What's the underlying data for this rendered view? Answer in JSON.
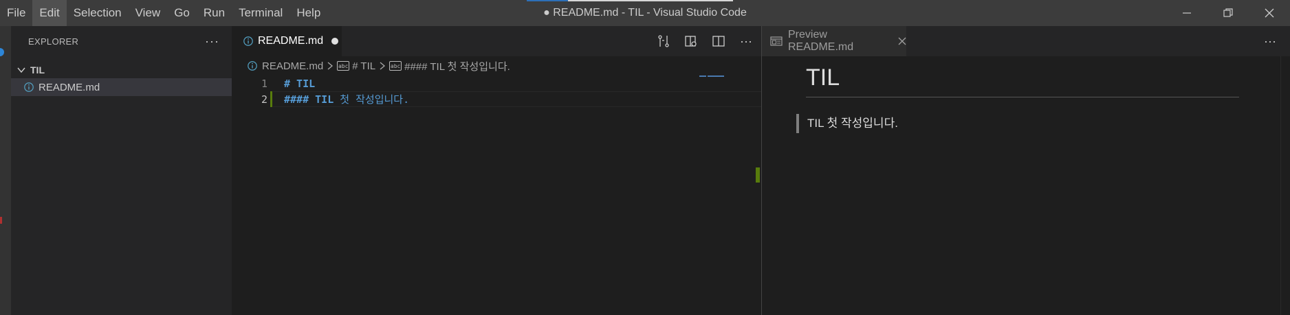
{
  "window": {
    "title": "● README.md - TIL - Visual Studio Code"
  },
  "menu": {
    "items": [
      "File",
      "Edit",
      "Selection",
      "View",
      "Go",
      "Run",
      "Terminal",
      "Help"
    ],
    "active": "Edit"
  },
  "sidebar": {
    "title": "EXPLORER",
    "more": "···",
    "folder": "TIL",
    "files": [
      {
        "name": "README.md",
        "icon": "info-icon"
      }
    ]
  },
  "editor": {
    "tab": {
      "label": "README.md",
      "dirty": true
    },
    "breadcrumb": {
      "file": "README.md",
      "h1": "# TIL",
      "h4": "#### TIL 첫 작성입니다."
    },
    "lines": [
      {
        "number": "1",
        "prefix": "# TIL",
        "rest": ""
      },
      {
        "number": "2",
        "prefix": "#### TIL ",
        "rest": "첫 작성입니다."
      }
    ],
    "actions": [
      "open-changes-icon",
      "open-preview-to-side-icon",
      "split-editor-icon",
      "more-actions-icon"
    ],
    "more": "···"
  },
  "preview": {
    "tab": {
      "label": "Preview README.md"
    },
    "more": "···",
    "heading": "TIL",
    "blockquote": "TIL 첫 작성입니다."
  },
  "colors": {
    "titlebar": "#3c3c3c",
    "sidebar": "#252526",
    "editor": "#1e1e1e",
    "heading_code": "#569cd6",
    "modified_gutter": "#587c0c"
  }
}
